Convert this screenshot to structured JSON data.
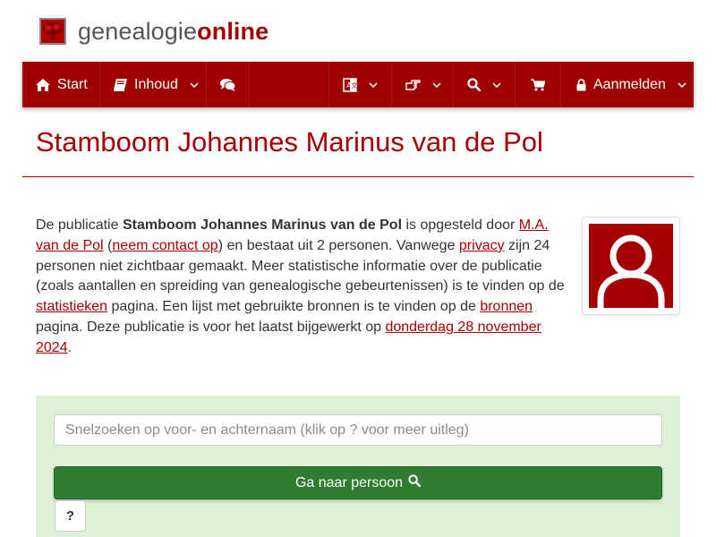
{
  "brand": {
    "part1": "genealogie",
    "part2": "online"
  },
  "nav": {
    "start_label": "Start",
    "inhoud_label": "Inhoud",
    "aanmelden_label": "Aanmelden",
    "icons": [
      "home-icon",
      "book-icon",
      "comments-icon",
      "translate-icon",
      "hand-pointer-icon",
      "search-icon",
      "cart-icon",
      "lock-icon",
      "chevron-down-icon"
    ]
  },
  "page": {
    "title": "Stamboom Johannes Marinus van de Pol"
  },
  "description": {
    "t1": "De publicatie ",
    "pub_name": "Stamboom Johannes Marinus van de Pol",
    "t2": " is opgesteld door ",
    "author_link": "M.A. van de Pol",
    "t3": " (",
    "contact_link": "neem contact op",
    "t4": ") en bestaat uit 2 personen. Vanwege ",
    "privacy_link": "privacy",
    "t5": " zijn 24 personen niet zichtbaar gemaakt. Meer statistische informatie over de publicatie (zoals aantallen en spreiding van genealogische gebeurtenissen) is te vinden op de ",
    "stats_link": "statistieken",
    "t6": " pagina. Een lijst met gebruikte bronnen is te vinden op de ",
    "sources_link": "bronnen",
    "t7": " pagina. Deze publicatie is voor het laatst bijgewerkt op ",
    "date_link": "donderdag 28 november 2024",
    "t8": "."
  },
  "search": {
    "placeholder": "Snelzoeken op voor- en achternaam (klik op ? voor meer uitleg)",
    "value": "",
    "go_label": "Ga naar persoon",
    "help_label": "?"
  },
  "colors": {
    "brand_red": "#a50000",
    "navbar": "#9e0000",
    "panel_green": "#dff0d8",
    "button_green": "#2e7d32"
  }
}
